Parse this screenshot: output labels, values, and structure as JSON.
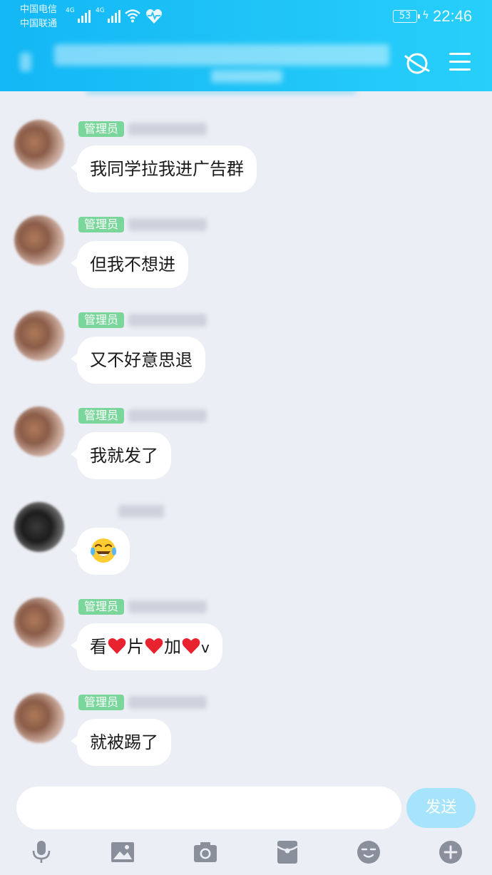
{
  "status_bar": {
    "carrier_1": "中国电信",
    "carrier_2": "中国联通",
    "network_1": "4G",
    "network_2": "4G",
    "battery": "53",
    "time": "22:46"
  },
  "header": {
    "icons": [
      "planet-icon",
      "menu-icon"
    ]
  },
  "messages": [
    {
      "role": "管理员",
      "text": "我同学拉我进广告群"
    },
    {
      "role": "管理员",
      "text": "但我不想进"
    },
    {
      "role": "管理员",
      "text": "又不好意思退"
    },
    {
      "role": "管理员",
      "text": "我就发了"
    },
    {
      "role": "",
      "emoji": "face-with-tears-of-joy-emoji"
    },
    {
      "role": "管理员",
      "text_parts": [
        "看",
        "片",
        "加",
        "v"
      ],
      "separator_icon": "red-heart-emoji"
    },
    {
      "role": "管理员",
      "text": "就被踢了"
    }
  ],
  "composer": {
    "input_value": "",
    "send_label": "发送",
    "colors": {
      "send_bg": "#a6e4fb",
      "header": "#12b7f5",
      "admin_badge": "#7ad69a"
    }
  },
  "toolbar": [
    "microphone-icon",
    "image-icon",
    "camera-icon",
    "red-packet-icon",
    "emoji-icon",
    "plus-icon"
  ]
}
